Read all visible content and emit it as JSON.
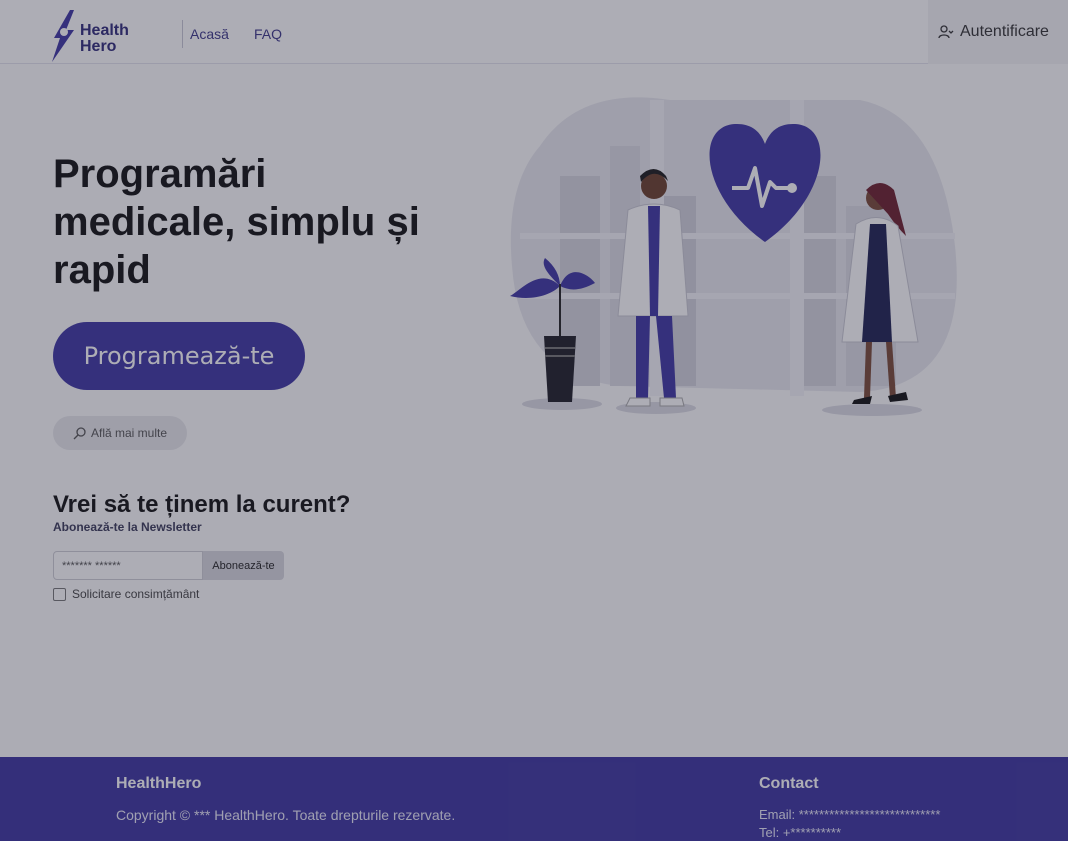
{
  "header": {
    "logo_line1": "Health",
    "logo_line2": "Hero",
    "nav": [
      {
        "label": "Acasă"
      },
      {
        "label": "FAQ"
      }
    ],
    "login_label": "Autentificare"
  },
  "hero": {
    "title": "Programări medicale, simplu și rapid",
    "cta_label": "Programează-te",
    "more_label": "Află mai multe"
  },
  "newsletter": {
    "title": "Vrei să te ținem la curent?",
    "subtitle": "Abonează-te la Newsletter",
    "email_value": "******* ******",
    "subscribe_label": "Abonează-te",
    "consent_label": "Solicitare consimțământ"
  },
  "footer": {
    "brand": "HealthHero",
    "copyright": "Copyright © *** HealthHero. Toate drepturile rezervate.",
    "contact_title": "Contact",
    "email": "Email: ****************************",
    "tel": "Tel: +**********"
  },
  "colors": {
    "brand": "#3e36a3",
    "footer": "#3d35a0"
  }
}
